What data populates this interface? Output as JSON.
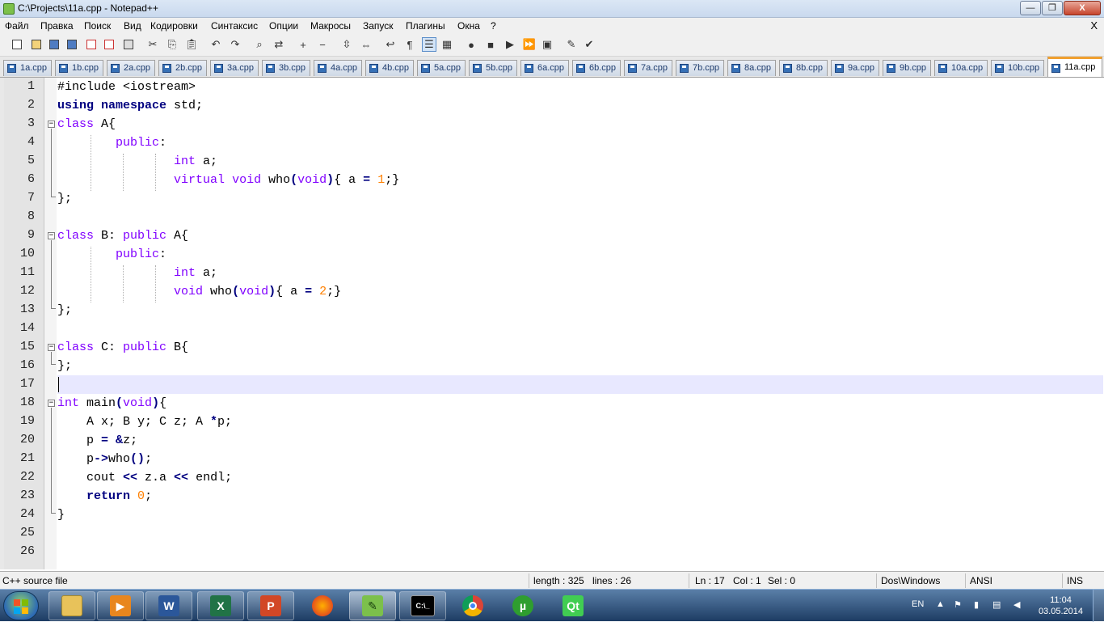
{
  "window": {
    "title": "C:\\Projects\\11a.cpp - Notepad++",
    "minimize": "—",
    "maximize": "❐",
    "close": "X"
  },
  "menu": {
    "items": [
      "Файл",
      "Правка",
      "Поиск",
      "Вид",
      "Кодировки",
      "Синтаксис",
      "Опции",
      "Макросы",
      "Запуск",
      "Плагины",
      "Окна",
      "?"
    ],
    "close": "X"
  },
  "toolbar": {
    "icons": [
      "new-file-icon",
      "open-file-icon",
      "save-icon",
      "save-all-icon",
      "close-icon",
      "close-all-icon",
      "print-icon",
      "cut-icon",
      "copy-icon",
      "paste-icon",
      "undo-icon",
      "redo-icon",
      "find-icon",
      "replace-icon",
      "zoom-in-icon",
      "zoom-out-icon",
      "sync-vertical-icon",
      "sync-horizontal-icon",
      "word-wrap-icon",
      "show-all-chars-icon",
      "indent-guide-icon",
      "doc-map-icon",
      "record-macro-icon",
      "stop-record-icon",
      "play-macro-icon",
      "run-macro-multiple-icon",
      "save-macro-icon",
      "spellcheck-icon",
      "abc-check-icon"
    ]
  },
  "tabs": [
    "1a.cpp",
    "1b.cpp",
    "2a.cpp",
    "2b.cpp",
    "3a.cpp",
    "3b.cpp",
    "4a.cpp",
    "4b.cpp",
    "5a.cpp",
    "5b.cpp",
    "6a.cpp",
    "6b.cpp",
    "7a.cpp",
    "7b.cpp",
    "8a.cpp",
    "8b.cpp",
    "9a.cpp",
    "9b.cpp",
    "10a.cpp",
    "10b.cpp",
    "11a.cpp"
  ],
  "active_tab": "11a.cpp",
  "editor": {
    "line_numbers": [
      "1",
      "2",
      "3",
      "4",
      "5",
      "6",
      "7",
      "8",
      "9",
      "10",
      "11",
      "12",
      "13",
      "14",
      "15",
      "16",
      "17",
      "18",
      "19",
      "20",
      "21",
      "22",
      "23",
      "24",
      "25",
      "26"
    ],
    "current_line": 17
  },
  "status": {
    "filetype": "C++ source file",
    "length": "length : 325",
    "lines": "lines : 26",
    "ln": "Ln : 17",
    "col": "Col : 1",
    "sel": "Sel : 0",
    "eol": "Dos\\Windows",
    "encoding": "ANSI",
    "mode": "INS"
  },
  "taskbar": {
    "apps": [
      "explorer",
      "media-player",
      "word",
      "excel",
      "powerpoint",
      "firefox",
      "notepad-plus-plus",
      "cmd",
      "chrome",
      "utorrent",
      "qt-creator"
    ],
    "lang": "EN",
    "time": "11:04",
    "date": "03.05.2014",
    "word_label": "W",
    "excel_label": "X",
    "ppt_label": "P",
    "qt_label": "Qt",
    "utorrent_label": "µ",
    "cmd_label": "C:\\_"
  }
}
